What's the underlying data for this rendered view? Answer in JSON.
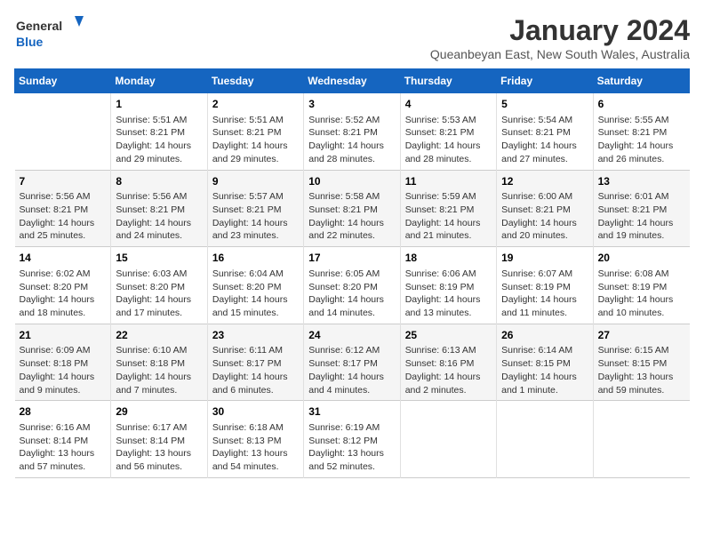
{
  "logo": {
    "line1": "General",
    "line2": "Blue"
  },
  "title": "January 2024",
  "subtitle": "Queanbeyan East, New South Wales, Australia",
  "weekdays": [
    "Sunday",
    "Monday",
    "Tuesday",
    "Wednesday",
    "Thursday",
    "Friday",
    "Saturday"
  ],
  "weeks": [
    [
      {
        "day": "",
        "sunrise": "",
        "sunset": "",
        "daylight": ""
      },
      {
        "day": "1",
        "sunrise": "Sunrise: 5:51 AM",
        "sunset": "Sunset: 8:21 PM",
        "daylight": "Daylight: 14 hours and 29 minutes."
      },
      {
        "day": "2",
        "sunrise": "Sunrise: 5:51 AM",
        "sunset": "Sunset: 8:21 PM",
        "daylight": "Daylight: 14 hours and 29 minutes."
      },
      {
        "day": "3",
        "sunrise": "Sunrise: 5:52 AM",
        "sunset": "Sunset: 8:21 PM",
        "daylight": "Daylight: 14 hours and 28 minutes."
      },
      {
        "day": "4",
        "sunrise": "Sunrise: 5:53 AM",
        "sunset": "Sunset: 8:21 PM",
        "daylight": "Daylight: 14 hours and 28 minutes."
      },
      {
        "day": "5",
        "sunrise": "Sunrise: 5:54 AM",
        "sunset": "Sunset: 8:21 PM",
        "daylight": "Daylight: 14 hours and 27 minutes."
      },
      {
        "day": "6",
        "sunrise": "Sunrise: 5:55 AM",
        "sunset": "Sunset: 8:21 PM",
        "daylight": "Daylight: 14 hours and 26 minutes."
      }
    ],
    [
      {
        "day": "7",
        "sunrise": "Sunrise: 5:56 AM",
        "sunset": "Sunset: 8:21 PM",
        "daylight": "Daylight: 14 hours and 25 minutes."
      },
      {
        "day": "8",
        "sunrise": "Sunrise: 5:56 AM",
        "sunset": "Sunset: 8:21 PM",
        "daylight": "Daylight: 14 hours and 24 minutes."
      },
      {
        "day": "9",
        "sunrise": "Sunrise: 5:57 AM",
        "sunset": "Sunset: 8:21 PM",
        "daylight": "Daylight: 14 hours and 23 minutes."
      },
      {
        "day": "10",
        "sunrise": "Sunrise: 5:58 AM",
        "sunset": "Sunset: 8:21 PM",
        "daylight": "Daylight: 14 hours and 22 minutes."
      },
      {
        "day": "11",
        "sunrise": "Sunrise: 5:59 AM",
        "sunset": "Sunset: 8:21 PM",
        "daylight": "Daylight: 14 hours and 21 minutes."
      },
      {
        "day": "12",
        "sunrise": "Sunrise: 6:00 AM",
        "sunset": "Sunset: 8:21 PM",
        "daylight": "Daylight: 14 hours and 20 minutes."
      },
      {
        "day": "13",
        "sunrise": "Sunrise: 6:01 AM",
        "sunset": "Sunset: 8:21 PM",
        "daylight": "Daylight: 14 hours and 19 minutes."
      }
    ],
    [
      {
        "day": "14",
        "sunrise": "Sunrise: 6:02 AM",
        "sunset": "Sunset: 8:20 PM",
        "daylight": "Daylight: 14 hours and 18 minutes."
      },
      {
        "day": "15",
        "sunrise": "Sunrise: 6:03 AM",
        "sunset": "Sunset: 8:20 PM",
        "daylight": "Daylight: 14 hours and 17 minutes."
      },
      {
        "day": "16",
        "sunrise": "Sunrise: 6:04 AM",
        "sunset": "Sunset: 8:20 PM",
        "daylight": "Daylight: 14 hours and 15 minutes."
      },
      {
        "day": "17",
        "sunrise": "Sunrise: 6:05 AM",
        "sunset": "Sunset: 8:20 PM",
        "daylight": "Daylight: 14 hours and 14 minutes."
      },
      {
        "day": "18",
        "sunrise": "Sunrise: 6:06 AM",
        "sunset": "Sunset: 8:19 PM",
        "daylight": "Daylight: 14 hours and 13 minutes."
      },
      {
        "day": "19",
        "sunrise": "Sunrise: 6:07 AM",
        "sunset": "Sunset: 8:19 PM",
        "daylight": "Daylight: 14 hours and 11 minutes."
      },
      {
        "day": "20",
        "sunrise": "Sunrise: 6:08 AM",
        "sunset": "Sunset: 8:19 PM",
        "daylight": "Daylight: 14 hours and 10 minutes."
      }
    ],
    [
      {
        "day": "21",
        "sunrise": "Sunrise: 6:09 AM",
        "sunset": "Sunset: 8:18 PM",
        "daylight": "Daylight: 14 hours and 9 minutes."
      },
      {
        "day": "22",
        "sunrise": "Sunrise: 6:10 AM",
        "sunset": "Sunset: 8:18 PM",
        "daylight": "Daylight: 14 hours and 7 minutes."
      },
      {
        "day": "23",
        "sunrise": "Sunrise: 6:11 AM",
        "sunset": "Sunset: 8:17 PM",
        "daylight": "Daylight: 14 hours and 6 minutes."
      },
      {
        "day": "24",
        "sunrise": "Sunrise: 6:12 AM",
        "sunset": "Sunset: 8:17 PM",
        "daylight": "Daylight: 14 hours and 4 minutes."
      },
      {
        "day": "25",
        "sunrise": "Sunrise: 6:13 AM",
        "sunset": "Sunset: 8:16 PM",
        "daylight": "Daylight: 14 hours and 2 minutes."
      },
      {
        "day": "26",
        "sunrise": "Sunrise: 6:14 AM",
        "sunset": "Sunset: 8:15 PM",
        "daylight": "Daylight: 14 hours and 1 minute."
      },
      {
        "day": "27",
        "sunrise": "Sunrise: 6:15 AM",
        "sunset": "Sunset: 8:15 PM",
        "daylight": "Daylight: 13 hours and 59 minutes."
      }
    ],
    [
      {
        "day": "28",
        "sunrise": "Sunrise: 6:16 AM",
        "sunset": "Sunset: 8:14 PM",
        "daylight": "Daylight: 13 hours and 57 minutes."
      },
      {
        "day": "29",
        "sunrise": "Sunrise: 6:17 AM",
        "sunset": "Sunset: 8:14 PM",
        "daylight": "Daylight: 13 hours and 56 minutes."
      },
      {
        "day": "30",
        "sunrise": "Sunrise: 6:18 AM",
        "sunset": "Sunset: 8:13 PM",
        "daylight": "Daylight: 13 hours and 54 minutes."
      },
      {
        "day": "31",
        "sunrise": "Sunrise: 6:19 AM",
        "sunset": "Sunset: 8:12 PM",
        "daylight": "Daylight: 13 hours and 52 minutes."
      },
      {
        "day": "",
        "sunrise": "",
        "sunset": "",
        "daylight": ""
      },
      {
        "day": "",
        "sunrise": "",
        "sunset": "",
        "daylight": ""
      },
      {
        "day": "",
        "sunrise": "",
        "sunset": "",
        "daylight": ""
      }
    ]
  ]
}
